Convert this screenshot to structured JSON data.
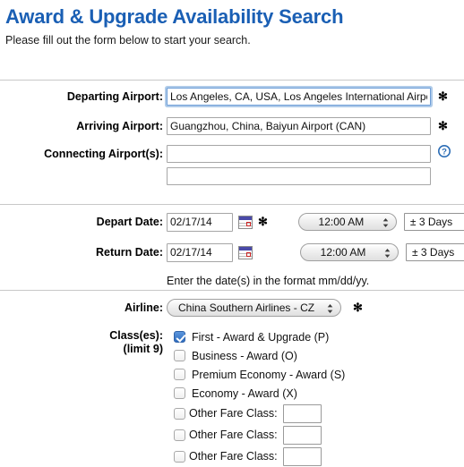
{
  "header": {
    "title": "Award & Upgrade Availability Search",
    "subtitle": "Please fill out the form below to start your search."
  },
  "required_marker": "✻",
  "icons": {
    "help": "help-circle-icon",
    "calendar": "calendar-icon",
    "stepper": "stepper-arrows-icon",
    "dropdown": "triangle-down-icon"
  },
  "colors": {
    "title": "#1a5fb4",
    "focus_ring": "#6f9fd8",
    "checkbox_checked": "#2f6cbe",
    "help_icon": "#2a6cb5",
    "divider": "#c8c8c8"
  },
  "route": {
    "departing_label": "Departing Airport:",
    "departing_value": "Los Angeles, CA, USA, Los Angeles International Airpo",
    "arriving_label": "Arriving Airport:",
    "arriving_value": "Guangzhou, China, Baiyun Airport (CAN)",
    "connecting_label": "Connecting Airport(s):",
    "connecting_value_1": "",
    "connecting_value_2": ""
  },
  "dates": {
    "depart_label": "Depart Date:",
    "depart_value": "02/17/14",
    "return_label": "Return Date:",
    "return_value": "02/17/14",
    "depart_time": "12:00 AM",
    "return_time": "12:00 AM",
    "depart_window": "± 3 Days",
    "return_window": "± 3 Days",
    "format_hint": "Enter the date(s) in the format mm/dd/yy."
  },
  "airline": {
    "label": "Airline:",
    "value": "China Southern Airlines - CZ"
  },
  "classes": {
    "label": "Class(es):",
    "limit_label": "(limit 9)",
    "options": [
      {
        "label": "First - Award & Upgrade (P)",
        "checked": true
      },
      {
        "label": "Business - Award (O)",
        "checked": false
      },
      {
        "label": "Premium Economy - Award (S)",
        "checked": false
      },
      {
        "label": "Economy - Award (X)",
        "checked": false
      }
    ],
    "other": [
      {
        "label": "Other Fare Class:",
        "checked": false,
        "value": ""
      },
      {
        "label": "Other Fare Class:",
        "checked": false,
        "value": ""
      },
      {
        "label": "Other Fare Class:",
        "checked": false,
        "value": ""
      }
    ]
  }
}
